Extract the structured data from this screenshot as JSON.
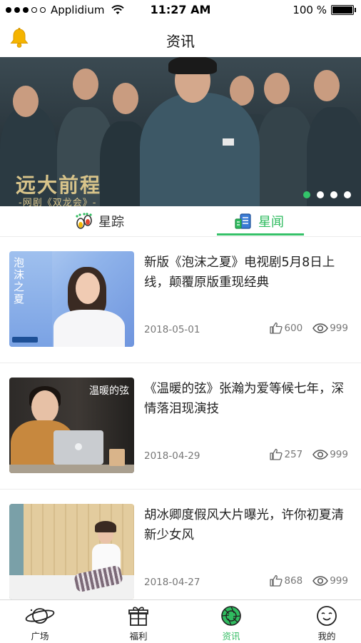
{
  "status_bar": {
    "carrier": "Applidium",
    "time": "11:27 AM",
    "battery": "100 %"
  },
  "header": {
    "title": "资讯"
  },
  "banner": {
    "logo_main": "远大前程",
    "logo_sub": "-网剧《双龙会》-",
    "slide_count": 4,
    "active_slide": 1
  },
  "tabs": [
    {
      "label": "星踪",
      "active": false
    },
    {
      "label": "星闻",
      "active": true
    }
  ],
  "articles": [
    {
      "title": "新版《泡沫之夏》电视剧5月8日上线，颠覆原版重现经典",
      "date": "2018-05-01",
      "likes": "600",
      "views": "999",
      "thumb_caption": "泡沫之夏"
    },
    {
      "title": "《温暖的弦》张瀚为爱等候七年，深情落泪现演技",
      "date": "2018-04-29",
      "likes": "257",
      "views": "999",
      "thumb_caption": "温暖的弦"
    },
    {
      "title": "胡冰卿度假风大片曝光，许你初夏清新少女风",
      "date": "2018-04-27",
      "likes": "868",
      "views": "999"
    }
  ],
  "tabbar": [
    {
      "label": "广场",
      "icon": "planet-icon",
      "active": false
    },
    {
      "label": "福利",
      "icon": "gift-icon",
      "active": false
    },
    {
      "label": "资讯",
      "icon": "camera-lens-icon",
      "active": true
    },
    {
      "label": "我的",
      "icon": "smiley-face-icon",
      "active": false
    }
  ],
  "colors": {
    "accent": "#2fbb5f",
    "bell": "#f5b400"
  }
}
